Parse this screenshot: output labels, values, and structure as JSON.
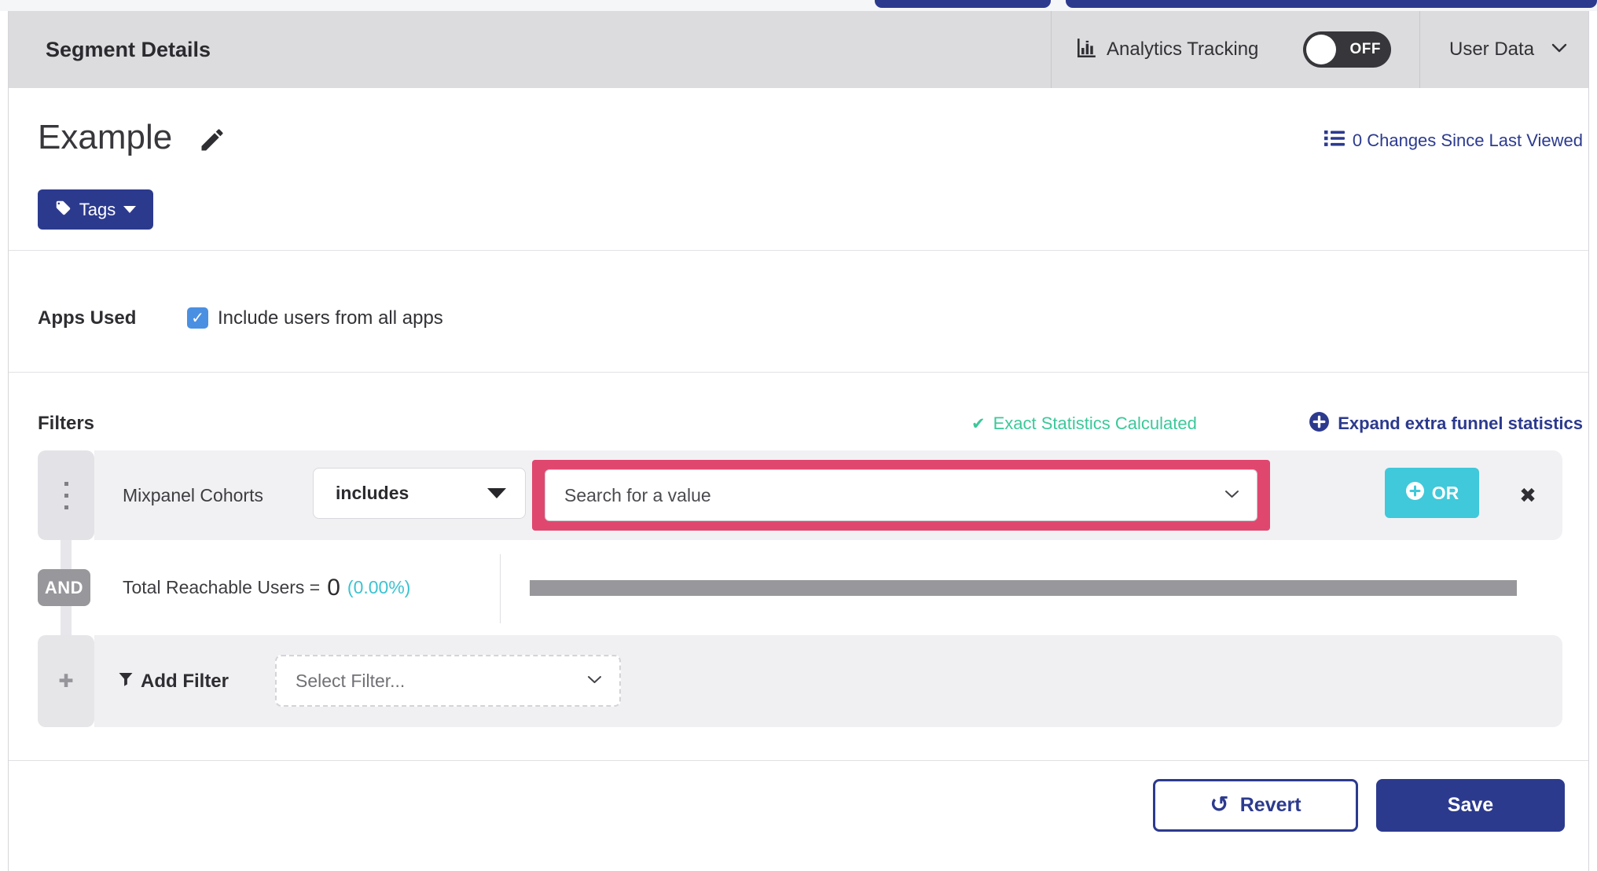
{
  "header": {
    "title": "Segment Details",
    "analytics_label": "Analytics Tracking",
    "toggle_state": "OFF",
    "user_data_label": "User Data"
  },
  "segment": {
    "name": "Example",
    "tags_label": "Tags",
    "changes_link": "0 Changes Since Last Viewed"
  },
  "apps": {
    "label": "Apps Used",
    "checkbox_label": "Include users from all apps",
    "checkbox_checked": true
  },
  "filters": {
    "title": "Filters",
    "exact_stats": "Exact Statistics Calculated",
    "expand_link": "Expand extra funnel statistics",
    "row": {
      "field": "Mixpanel Cohorts",
      "operator": "includes",
      "value_placeholder": "Search for a value",
      "or_label": "OR"
    },
    "and_label": "AND",
    "reach": {
      "label": "Total Reachable Users =",
      "value": "0",
      "percent": "(0.00%)"
    },
    "add": {
      "label": "Add Filter",
      "select_placeholder": "Select Filter..."
    }
  },
  "footer": {
    "revert_label": "Revert",
    "save_label": "Save"
  },
  "icons": {
    "check": "✓",
    "check_heavy": "✔",
    "close": "✖",
    "plus_heavy": "✚",
    "undo": "↺"
  },
  "colors": {
    "brand_blue": "#2c3a8e",
    "teal_success": "#3bc89b",
    "cyan_accent": "#3fc9da",
    "pink_highlight": "#e0476f",
    "checkbox_blue": "#4a90e2",
    "toggle_dark": "#37373b",
    "header_gray": "#dcdcdf",
    "meter_gray": "#98989c"
  }
}
